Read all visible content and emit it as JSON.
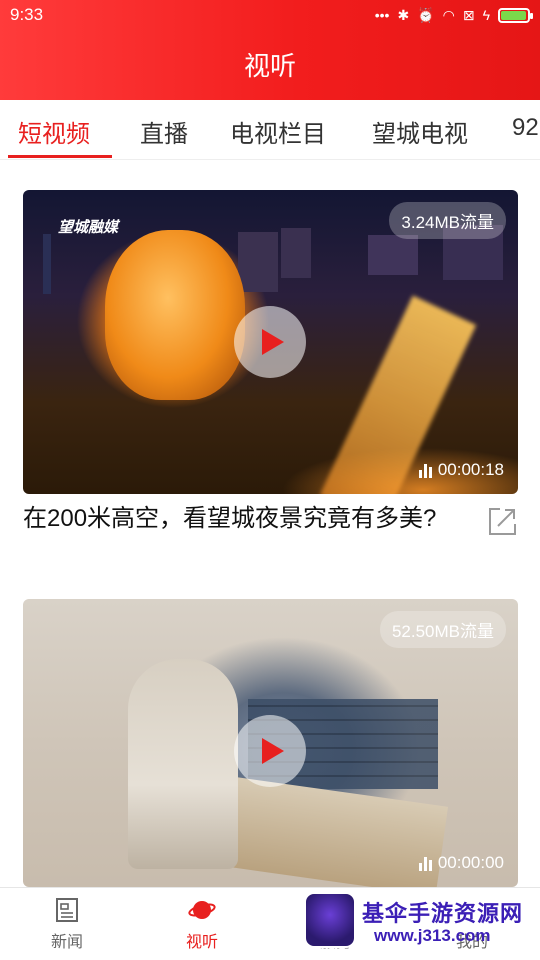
{
  "status_bar": {
    "time": "9:33",
    "icons": [
      "more-dots-icon",
      "bluetooth-icon",
      "alarm-icon",
      "wifi-icon",
      "no-sim-icon",
      "charging-icon"
    ],
    "battery_level": 0.95
  },
  "header": {
    "title": "视听"
  },
  "tabs": [
    {
      "label": "短视频",
      "active": true
    },
    {
      "label": "直播"
    },
    {
      "label": "电视栏目"
    },
    {
      "label": "望城电视"
    },
    {
      "label": "92"
    }
  ],
  "videos": [
    {
      "size_badge": "3.24MB流量",
      "duration": "00:00:18",
      "title": "在200米高空，看望城夜景究竟有多美?",
      "logo": "望城融媒"
    },
    {
      "size_badge": "52.50MB流量",
      "duration": "00:00:00",
      "title": ""
    }
  ],
  "bottom_nav": [
    {
      "label": "新闻",
      "icon": "news-icon"
    },
    {
      "label": "视听",
      "icon": "planet-icon",
      "active": true
    },
    {
      "label": "服务",
      "icon": "service-icon"
    },
    {
      "label": "我的",
      "icon": "user-icon"
    }
  ],
  "watermark": {
    "title": "基伞手游资源网",
    "url": "www.j313.com"
  },
  "colors": {
    "brand_red": "#e8201f",
    "header_red": "#f21d1d"
  }
}
